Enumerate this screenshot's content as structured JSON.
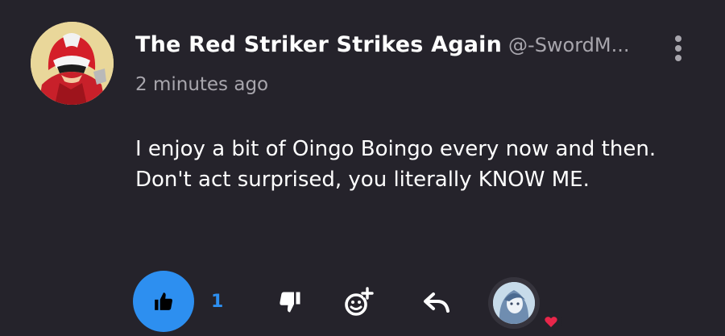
{
  "comment": {
    "author_name": "The Red Striker Strikes Again",
    "author_handle": "@-SwordM...",
    "timestamp": "2 minutes ago",
    "text": "I enjoy a bit of Oingo Boingo every now and then. Don't act surprised, you literally KNOW ME."
  },
  "actions": {
    "like_count": "1"
  },
  "icons": {
    "menu": "kebab-icon",
    "like": "thumbs-up-icon",
    "dislike": "thumbs-down-icon",
    "add_reaction": "add-emoji-icon",
    "reply": "reply-icon",
    "heart": "heart-icon"
  },
  "colors": {
    "background": "#25232b",
    "accent": "#2d8ff0",
    "heart": "#e8264a",
    "muted_text": "#a8a6ad"
  }
}
